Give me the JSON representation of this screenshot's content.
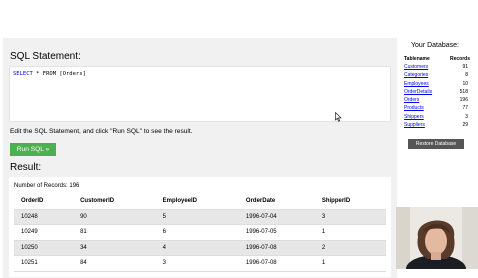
{
  "sql_section": {
    "heading": "SQL Statement:",
    "query_keyword": "SELECT",
    "query_rest": " * FROM [Orders]",
    "hint": "Edit the SQL Statement, and click \"Run SQL\" to see the result.",
    "run_button": "Run SQL »"
  },
  "result_section": {
    "heading": "Result:",
    "record_count": "Number of Records: 196",
    "columns": [
      "OrderID",
      "CustomerID",
      "EmployeeID",
      "OrderDate",
      "ShipperID"
    ],
    "rows": [
      [
        "10248",
        "90",
        "5",
        "1996-07-04",
        "3"
      ],
      [
        "10249",
        "81",
        "6",
        "1996-07-05",
        "1"
      ],
      [
        "10250",
        "34",
        "4",
        "1996-07-08",
        "2"
      ],
      [
        "10251",
        "84",
        "3",
        "1996-07-08",
        "1"
      ]
    ]
  },
  "database": {
    "title": "Your Database:",
    "col_table": "Tablename",
    "col_records": "Records",
    "tables": [
      {
        "name": "Customers",
        "records": "91"
      },
      {
        "name": "Categories",
        "records": "8"
      },
      {
        "name": "Employees",
        "records": "10"
      },
      {
        "name": "OrderDetails",
        "records": "518"
      },
      {
        "name": "Orders",
        "records": "196"
      },
      {
        "name": "Products",
        "records": "77"
      },
      {
        "name": "Shippers",
        "records": "3"
      },
      {
        "name": "Suppliers",
        "records": "29"
      }
    ],
    "restore_button": "Restore Database"
  },
  "colors": {
    "run_button": "#4caf50",
    "restore_button": "#555555",
    "panel_background": "#f1f1f1",
    "sql_keyword": "#0000cd",
    "link": "#0000ee"
  },
  "icons": [
    "mouse-cursor-icon"
  ]
}
